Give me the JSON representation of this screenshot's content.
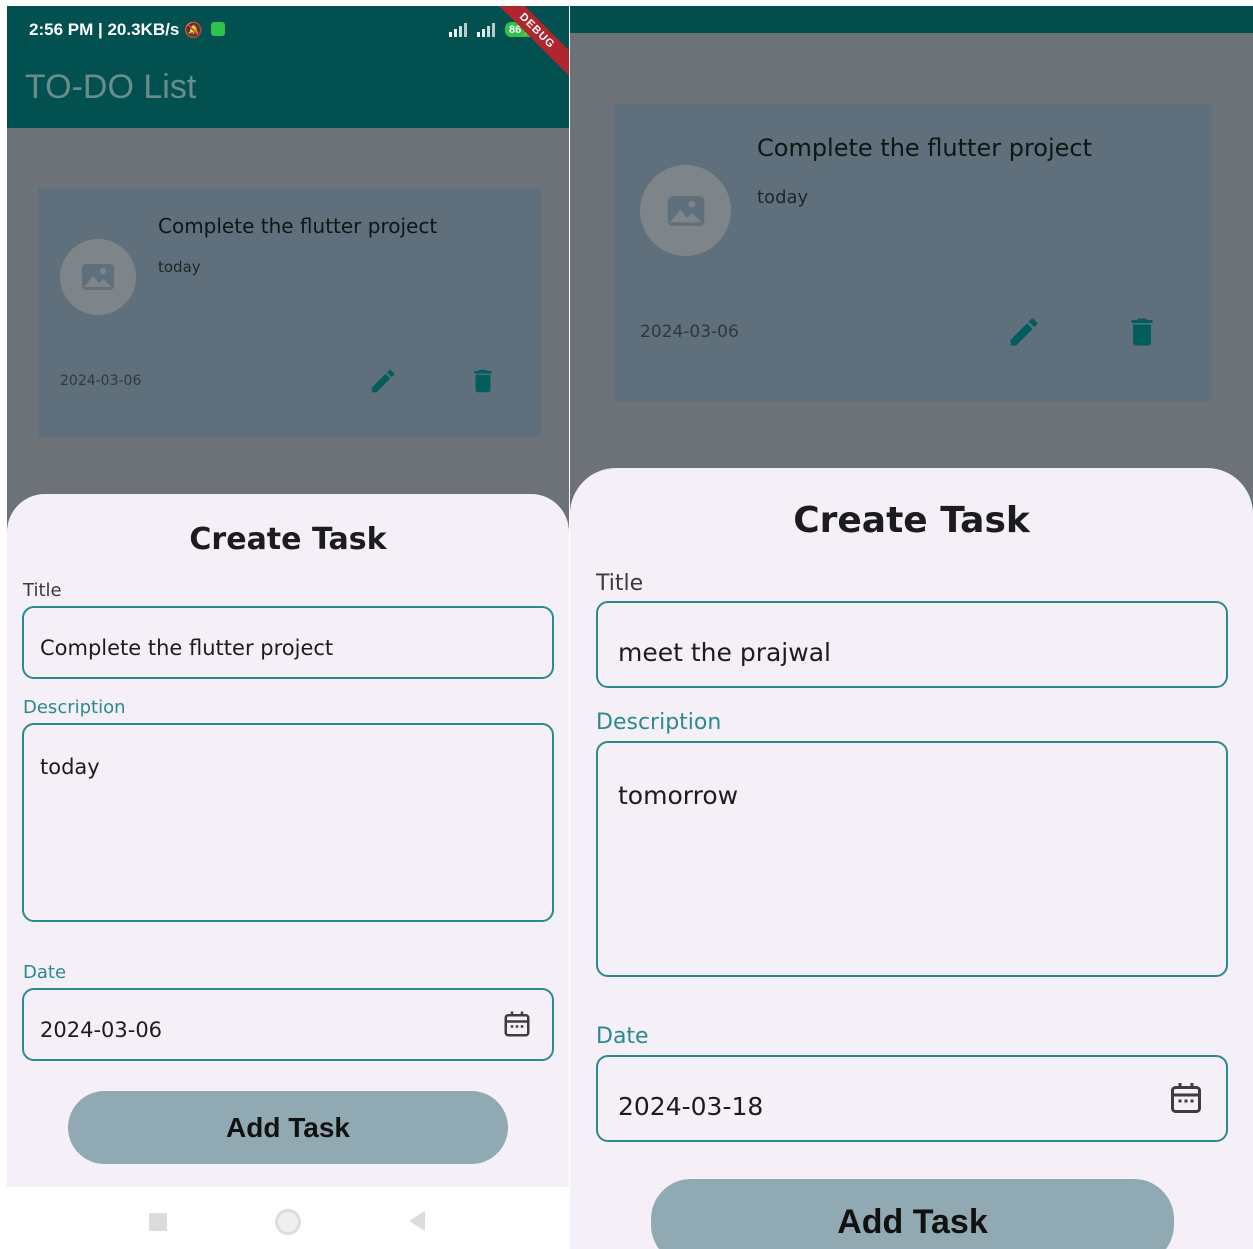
{
  "left": {
    "status": {
      "time_speed": "2:56 PM | 20.3KB/s",
      "battery": "86",
      "debug_ribbon": "DEBUG"
    },
    "app_title": "TO-DO List",
    "task": {
      "title": "Complete the flutter project",
      "description": "today",
      "date": "2024-03-06"
    },
    "sheet": {
      "heading": "Create Task",
      "title_label": "Title",
      "title_value": "Complete the flutter project",
      "description_label": "Description",
      "description_value": "today",
      "date_label": "Date",
      "date_value": "2024-03-06",
      "button": "Add Task"
    }
  },
  "right": {
    "task": {
      "title": "Complete the flutter project",
      "description": "today",
      "date": "2024-03-06"
    },
    "sheet": {
      "heading": "Create Task",
      "title_label": "Title",
      "title_value": "meet the prajwal",
      "description_label": "Description",
      "description_value": "tomorrow",
      "date_label": "Date",
      "date_value": "2024-03-18",
      "button": "Add Task"
    }
  },
  "colors": {
    "appbar": "#02504f",
    "accent": "#2a8a8e",
    "icon": "#025e5c",
    "sheet_bg": "#f5f0f8",
    "button": "#91a9b2"
  },
  "icons": [
    "image-icon",
    "pencil-icon",
    "trash-icon",
    "calendar-icon"
  ]
}
